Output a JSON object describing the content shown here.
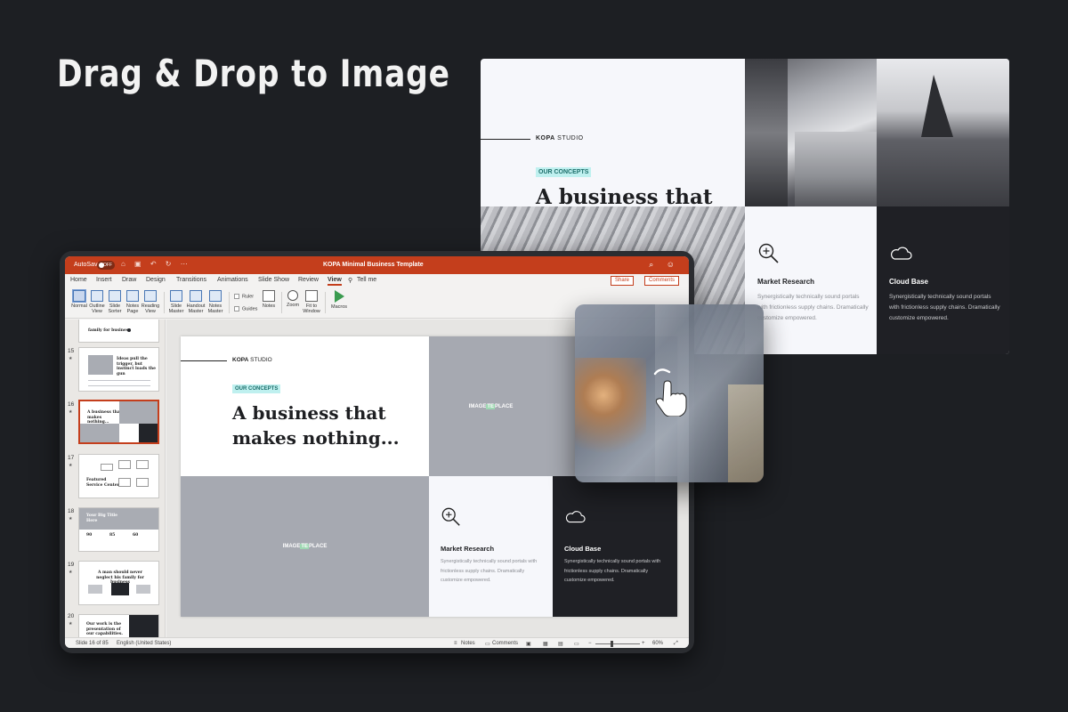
{
  "headline": "Drag & Drop to Image",
  "preview_slide": {
    "brand_bold": "KOPA",
    "brand_rest": " STUDIO",
    "tag": "OUR CONCEPTS",
    "title": "A business that makes nothing...",
    "cards": [
      {
        "icon": "magnifier-plus-icon",
        "title": "Market Research",
        "desc": "Synergistically technically sound portals with frictionless supply chains. Dramatically customize empowered."
      },
      {
        "icon": "cloud-icon",
        "title": "Cloud Base",
        "desc": "Synergistically technically sound portals with frictionless supply chains. Dramatically customize empowered."
      }
    ]
  },
  "app": {
    "autosave_label": "AutoSave",
    "autosave_state": "OFF",
    "document_title": "KOPA Minimal Business Template",
    "tabs": [
      "Home",
      "Insert",
      "Draw",
      "Design",
      "Transitions",
      "Animations",
      "Slide Show",
      "Review",
      "View",
      "Tell me"
    ],
    "active_tab": "View",
    "share_label": "Share",
    "comments_label": "Comments",
    "ribbon": {
      "normal": "Normal",
      "outline_view": "Outline View",
      "slide_sorter": "Slide Sorter",
      "notes_page": "Notes Page",
      "reading_view": "Reading View",
      "slide_master": "Slide Master",
      "handout_master": "Handout Master",
      "notes_master": "Notes Master",
      "ruler": "Ruler",
      "guides": "Guides",
      "notes": "Notes",
      "zoom": "Zoom",
      "fit_to_window": "Fit to Window",
      "macros": "Macros"
    },
    "thumbnails": [
      {
        "num": "",
        "text": "family for business"
      },
      {
        "num": "15",
        "text": "Ideas pull the trigger, but instinct loads the gun"
      },
      {
        "num": "16",
        "text": "A business that makes nothing..."
      },
      {
        "num": "17",
        "text": "Featured Service Center"
      },
      {
        "num": "18",
        "text": "Your Big Title Here"
      },
      {
        "num": "19",
        "text": "A man should never neglect his family for business"
      },
      {
        "num": "20",
        "text": "Our work is the presentation of our capabilities."
      }
    ],
    "thumb18_stats": [
      "90",
      "85",
      "60"
    ],
    "slide": {
      "brand_bold": "KOPA",
      "brand_rest": " STUDIO",
      "tag": "OUR CONCEPTS",
      "title": "A business that makes nothing...",
      "placeholder_pre": "IMAGE",
      "placeholder_mid": "TE",
      "placeholder_post": "PLACE",
      "cards": [
        {
          "icon": "magnifier-plus-icon",
          "title": "Market Research",
          "desc": "Synergistically technically sound portals with frictionless supply chains. Dramatically customize empowered."
        },
        {
          "icon": "cloud-icon",
          "title": "Cloud Base",
          "desc": "Synergistically technically sound portals with frictionless supply chains. Dramatically customize empowered."
        }
      ]
    },
    "status": {
      "slide_count": "Slide 16 of 85",
      "language": "English (United States)",
      "notes": "Notes",
      "comments": "Comments",
      "zoom": "60%"
    }
  },
  "colors": {
    "accent": "#c43e1c",
    "background": "#1d1f23",
    "tag_bg": "#bff0ef",
    "dark_card": "#1f2025"
  }
}
